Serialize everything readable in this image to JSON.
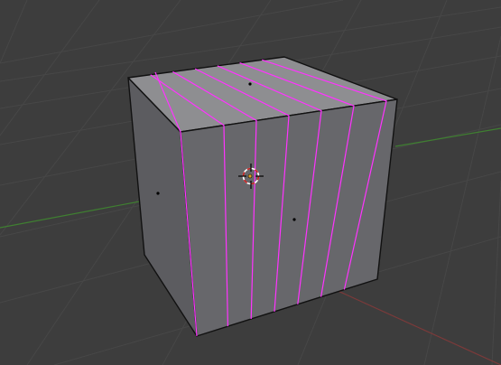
{
  "viewport": {
    "background_color": "#3d3d3d",
    "grid_color": "#474747",
    "x_axis_color": "#7b3a3a",
    "y_axis_color": "#3f7f31",
    "object": {
      "type": "cube",
      "top_color": "#8e8e91",
      "front_color": "#67676b",
      "side_color": "#5c5c60",
      "edge_color": "#111111",
      "edge_loop_color": "#ff33ff",
      "edge_loop_count": 6
    },
    "cursor": {
      "icon": "3d-cursor-icon",
      "ring_color_a": "#ffffff",
      "ring_color_b": "#c61f1f"
    },
    "origin": {
      "icon": "object-origin-icon",
      "color": "#e0a020"
    },
    "markers": {
      "icon": "face-dot-icon",
      "color": "#000000"
    }
  }
}
